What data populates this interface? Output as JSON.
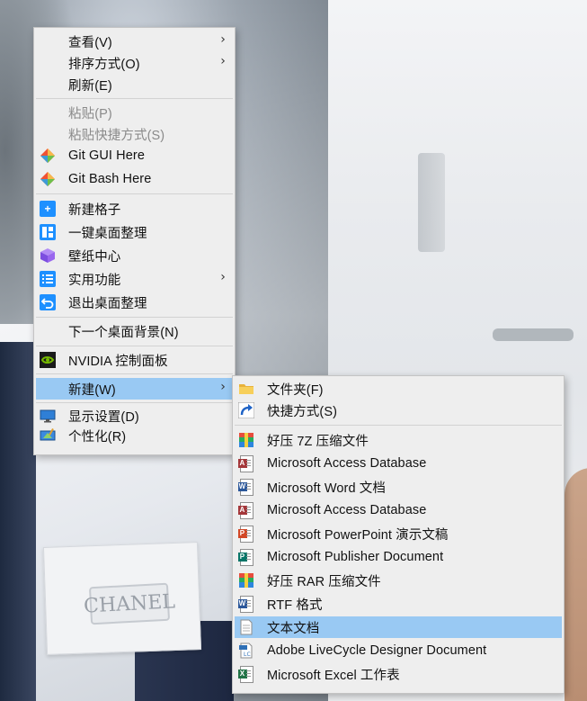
{
  "wallpaper": {
    "pocket_label": "CHANEL"
  },
  "main_menu": {
    "items": [
      {
        "label": "查看(V)",
        "has_submenu": true
      },
      {
        "label": "排序方式(O)",
        "has_submenu": true
      },
      {
        "label": "刷新(E)"
      },
      {
        "label": "粘贴(P)",
        "disabled": true
      },
      {
        "label": "粘贴快捷方式(S)",
        "disabled": true
      },
      {
        "label": "Git GUI Here",
        "icon": "git-icon"
      },
      {
        "label": "Git Bash Here",
        "icon": "git-icon"
      },
      {
        "label": "新建格子",
        "icon": "plus-icon"
      },
      {
        "label": "一键桌面整理",
        "icon": "layout-icon"
      },
      {
        "label": "壁纸中心",
        "icon": "cube-icon"
      },
      {
        "label": "实用功能",
        "icon": "list-icon",
        "has_submenu": true
      },
      {
        "label": "退出桌面整理",
        "icon": "exit-icon"
      },
      {
        "label": "下一个桌面背景(N)"
      },
      {
        "label": "NVIDIA 控制面板",
        "icon": "nvidia-icon"
      },
      {
        "label": "新建(W)",
        "has_submenu": true,
        "selected": true
      },
      {
        "label": "显示设置(D)",
        "icon": "display-icon"
      },
      {
        "label": "个性化(R)",
        "icon": "personalize-icon"
      }
    ]
  },
  "new_submenu": {
    "items": [
      {
        "label": "文件夹(F)",
        "icon": "folder-icon"
      },
      {
        "label": "快捷方式(S)",
        "icon": "shortcut-icon"
      },
      {
        "label": "好压 7Z 压缩文件",
        "icon": "archive-icon"
      },
      {
        "label": "Microsoft Access Database",
        "icon": "access-icon"
      },
      {
        "label": "Microsoft Word 文档",
        "icon": "word-icon"
      },
      {
        "label": "Microsoft Access Database",
        "icon": "access-icon"
      },
      {
        "label": "Microsoft PowerPoint 演示文稿",
        "icon": "powerpoint-icon"
      },
      {
        "label": "Microsoft Publisher Document",
        "icon": "publisher-icon"
      },
      {
        "label": "好压 RAR 压缩文件",
        "icon": "archive-icon"
      },
      {
        "label": "RTF 格式",
        "icon": "rtf-icon"
      },
      {
        "label": "文本文档",
        "icon": "text-document-icon",
        "selected": true
      },
      {
        "label": "Adobe LiveCycle Designer Document",
        "icon": "livecycle-icon"
      },
      {
        "label": "Microsoft Excel 工作表",
        "icon": "excel-icon"
      }
    ]
  },
  "colors": {
    "menu_bg": "#eeeeee",
    "highlight": "#99c9f3",
    "disabled_text": "#8a8a8a"
  }
}
